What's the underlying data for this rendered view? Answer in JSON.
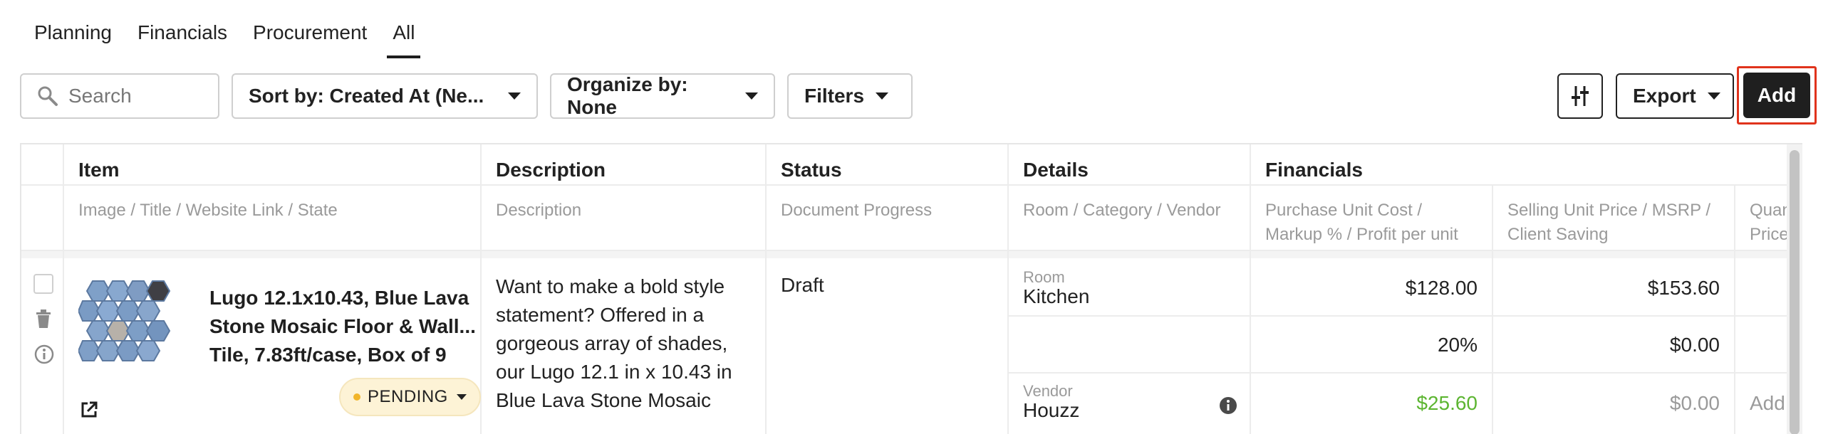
{
  "tabs": [
    {
      "label": "Planning",
      "active": false
    },
    {
      "label": "Financials",
      "active": false
    },
    {
      "label": "Procurement",
      "active": false
    },
    {
      "label": "All",
      "active": true
    }
  ],
  "toolbar": {
    "search_placeholder": "Search",
    "sort_label": "Sort by: Created At (Ne...",
    "organize_label": "Organize by: None",
    "filters_label": "Filters",
    "export_label": "Export",
    "add_label": "Add"
  },
  "table": {
    "headers": {
      "item": "Item",
      "description": "Description",
      "status": "Status",
      "details": "Details",
      "financials": "Financials"
    },
    "subheaders": {
      "item": "Image / Title / Website Link / State",
      "description": "Description",
      "status": "Document Progress",
      "details": "Room / Category / Vendor",
      "purchase_line1": "Purchase Unit Cost /",
      "purchase_line2": "Markup % / Profit per unit",
      "selling_line1": "Selling Unit Price / MSRP /",
      "selling_line2": "Client Saving",
      "quantity_line1": "Quan",
      "quantity_line2": "Price"
    },
    "row": {
      "title": "Lugo 12.1x10.43, Blue Lava Stone Mosaic Floor & Wall... Tile, 7.83ft/case, Box of 9",
      "state": "PENDING",
      "description": "Want to make a bold style statement? Offered in a gorgeous array of shades, our Lugo 12.1 in x 10.43 in Blue Lava Stone Mosaic",
      "status": "Draft",
      "room_label": "Room",
      "room": "Kitchen",
      "vendor_label": "Vendor",
      "vendor": "Houzz",
      "purchase_unit_cost": "$128.00",
      "markup": "20%",
      "profit_per_unit": "$25.60",
      "selling_unit_price": "$153.60",
      "msrp": "$0.00",
      "client_saving": "$0.00",
      "quantity_add": "Add"
    }
  },
  "colors": {
    "accent_dark": "#1f1f1f",
    "highlight_red": "#e0331c",
    "pending_bg": "#fdf3d6",
    "profit_green": "#5cb531"
  }
}
